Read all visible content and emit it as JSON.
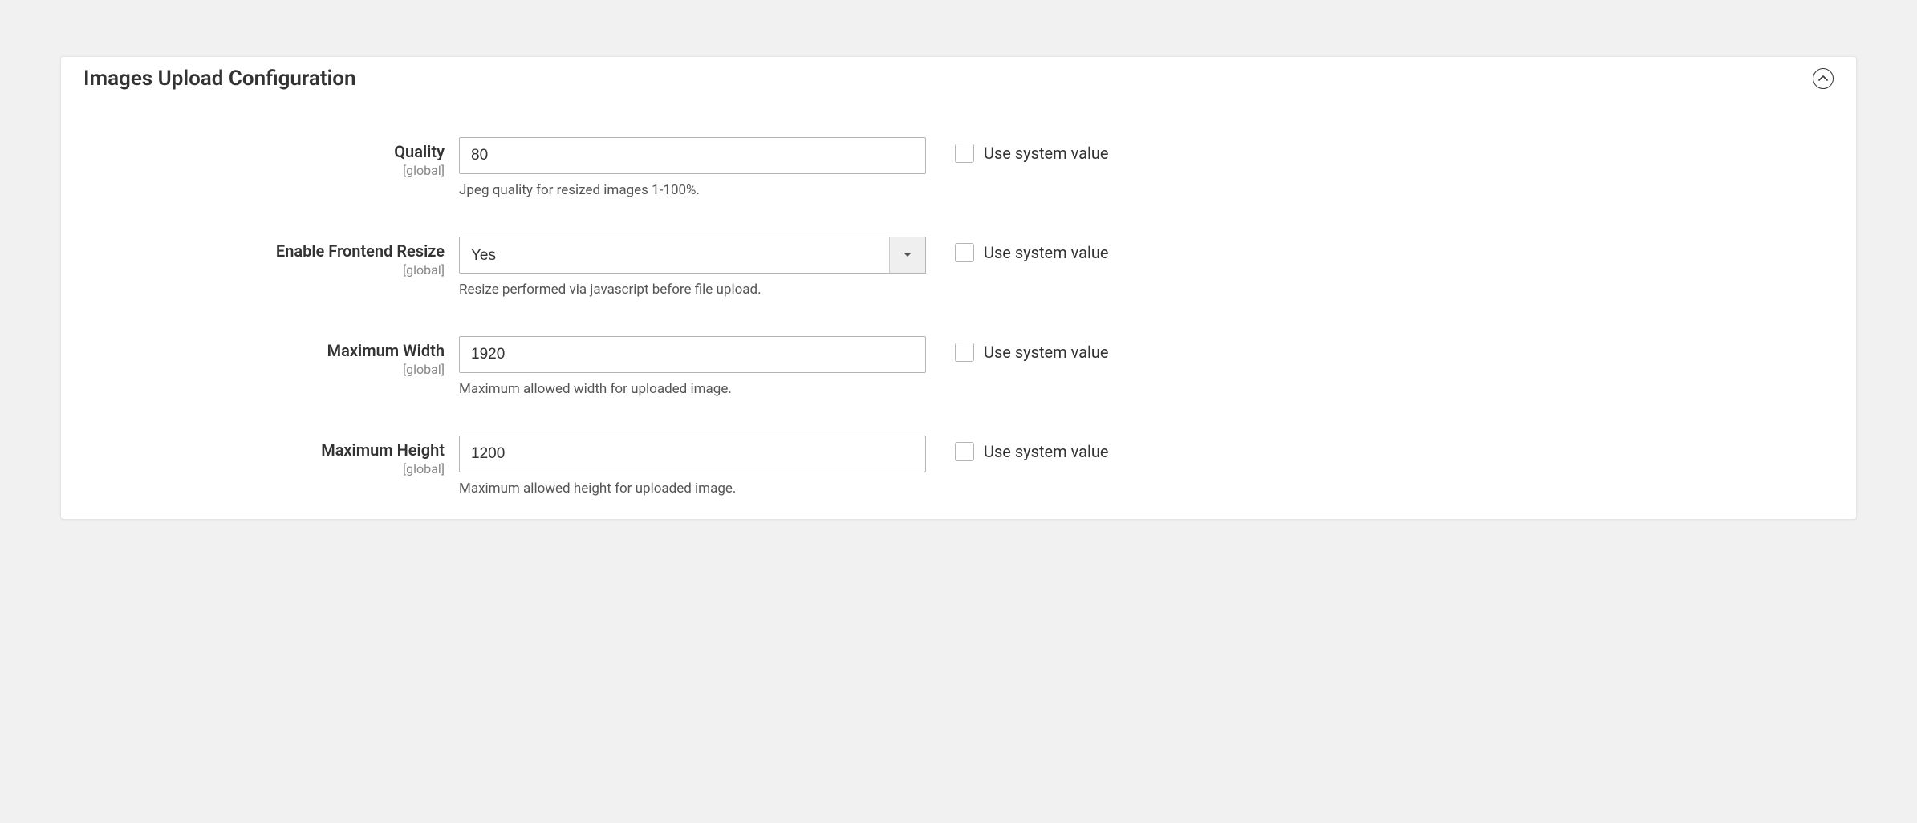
{
  "panel": {
    "title": "Images Upload Configuration"
  },
  "scope_label": "[global]",
  "use_system_label": "Use system value",
  "fields": {
    "quality": {
      "label": "Quality",
      "value": "80",
      "help": "Jpeg quality for resized images 1-100%."
    },
    "frontend_resize": {
      "label": "Enable Frontend Resize",
      "value": "Yes",
      "help": "Resize performed via javascript before file upload."
    },
    "max_width": {
      "label": "Maximum Width",
      "value": "1920",
      "help": "Maximum allowed width for uploaded image."
    },
    "max_height": {
      "label": "Maximum Height",
      "value": "1200",
      "help": "Maximum allowed height for uploaded image."
    }
  }
}
